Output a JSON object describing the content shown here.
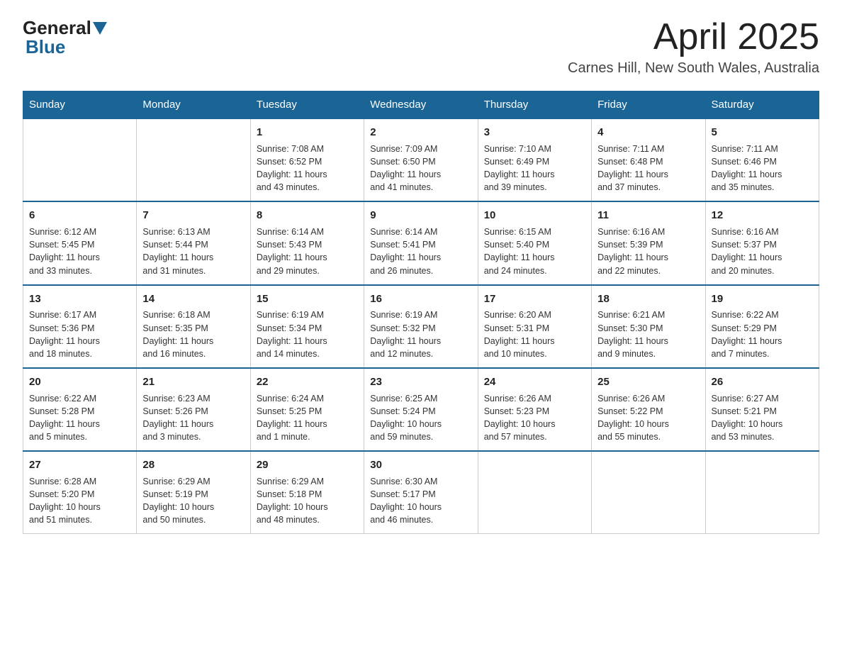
{
  "header": {
    "logo_text_general": "General",
    "logo_text_blue": "Blue",
    "month_title": "April 2025",
    "location": "Carnes Hill, New South Wales, Australia"
  },
  "days_of_week": [
    "Sunday",
    "Monday",
    "Tuesday",
    "Wednesday",
    "Thursday",
    "Friday",
    "Saturday"
  ],
  "weeks": [
    [
      {
        "day": "",
        "info": ""
      },
      {
        "day": "",
        "info": ""
      },
      {
        "day": "1",
        "info": "Sunrise: 7:08 AM\nSunset: 6:52 PM\nDaylight: 11 hours\nand 43 minutes."
      },
      {
        "day": "2",
        "info": "Sunrise: 7:09 AM\nSunset: 6:50 PM\nDaylight: 11 hours\nand 41 minutes."
      },
      {
        "day": "3",
        "info": "Sunrise: 7:10 AM\nSunset: 6:49 PM\nDaylight: 11 hours\nand 39 minutes."
      },
      {
        "day": "4",
        "info": "Sunrise: 7:11 AM\nSunset: 6:48 PM\nDaylight: 11 hours\nand 37 minutes."
      },
      {
        "day": "5",
        "info": "Sunrise: 7:11 AM\nSunset: 6:46 PM\nDaylight: 11 hours\nand 35 minutes."
      }
    ],
    [
      {
        "day": "6",
        "info": "Sunrise: 6:12 AM\nSunset: 5:45 PM\nDaylight: 11 hours\nand 33 minutes."
      },
      {
        "day": "7",
        "info": "Sunrise: 6:13 AM\nSunset: 5:44 PM\nDaylight: 11 hours\nand 31 minutes."
      },
      {
        "day": "8",
        "info": "Sunrise: 6:14 AM\nSunset: 5:43 PM\nDaylight: 11 hours\nand 29 minutes."
      },
      {
        "day": "9",
        "info": "Sunrise: 6:14 AM\nSunset: 5:41 PM\nDaylight: 11 hours\nand 26 minutes."
      },
      {
        "day": "10",
        "info": "Sunrise: 6:15 AM\nSunset: 5:40 PM\nDaylight: 11 hours\nand 24 minutes."
      },
      {
        "day": "11",
        "info": "Sunrise: 6:16 AM\nSunset: 5:39 PM\nDaylight: 11 hours\nand 22 minutes."
      },
      {
        "day": "12",
        "info": "Sunrise: 6:16 AM\nSunset: 5:37 PM\nDaylight: 11 hours\nand 20 minutes."
      }
    ],
    [
      {
        "day": "13",
        "info": "Sunrise: 6:17 AM\nSunset: 5:36 PM\nDaylight: 11 hours\nand 18 minutes."
      },
      {
        "day": "14",
        "info": "Sunrise: 6:18 AM\nSunset: 5:35 PM\nDaylight: 11 hours\nand 16 minutes."
      },
      {
        "day": "15",
        "info": "Sunrise: 6:19 AM\nSunset: 5:34 PM\nDaylight: 11 hours\nand 14 minutes."
      },
      {
        "day": "16",
        "info": "Sunrise: 6:19 AM\nSunset: 5:32 PM\nDaylight: 11 hours\nand 12 minutes."
      },
      {
        "day": "17",
        "info": "Sunrise: 6:20 AM\nSunset: 5:31 PM\nDaylight: 11 hours\nand 10 minutes."
      },
      {
        "day": "18",
        "info": "Sunrise: 6:21 AM\nSunset: 5:30 PM\nDaylight: 11 hours\nand 9 minutes."
      },
      {
        "day": "19",
        "info": "Sunrise: 6:22 AM\nSunset: 5:29 PM\nDaylight: 11 hours\nand 7 minutes."
      }
    ],
    [
      {
        "day": "20",
        "info": "Sunrise: 6:22 AM\nSunset: 5:28 PM\nDaylight: 11 hours\nand 5 minutes."
      },
      {
        "day": "21",
        "info": "Sunrise: 6:23 AM\nSunset: 5:26 PM\nDaylight: 11 hours\nand 3 minutes."
      },
      {
        "day": "22",
        "info": "Sunrise: 6:24 AM\nSunset: 5:25 PM\nDaylight: 11 hours\nand 1 minute."
      },
      {
        "day": "23",
        "info": "Sunrise: 6:25 AM\nSunset: 5:24 PM\nDaylight: 10 hours\nand 59 minutes."
      },
      {
        "day": "24",
        "info": "Sunrise: 6:26 AM\nSunset: 5:23 PM\nDaylight: 10 hours\nand 57 minutes."
      },
      {
        "day": "25",
        "info": "Sunrise: 6:26 AM\nSunset: 5:22 PM\nDaylight: 10 hours\nand 55 minutes."
      },
      {
        "day": "26",
        "info": "Sunrise: 6:27 AM\nSunset: 5:21 PM\nDaylight: 10 hours\nand 53 minutes."
      }
    ],
    [
      {
        "day": "27",
        "info": "Sunrise: 6:28 AM\nSunset: 5:20 PM\nDaylight: 10 hours\nand 51 minutes."
      },
      {
        "day": "28",
        "info": "Sunrise: 6:29 AM\nSunset: 5:19 PM\nDaylight: 10 hours\nand 50 minutes."
      },
      {
        "day": "29",
        "info": "Sunrise: 6:29 AM\nSunset: 5:18 PM\nDaylight: 10 hours\nand 48 minutes."
      },
      {
        "day": "30",
        "info": "Sunrise: 6:30 AM\nSunset: 5:17 PM\nDaylight: 10 hours\nand 46 minutes."
      },
      {
        "day": "",
        "info": ""
      },
      {
        "day": "",
        "info": ""
      },
      {
        "day": "",
        "info": ""
      }
    ]
  ]
}
